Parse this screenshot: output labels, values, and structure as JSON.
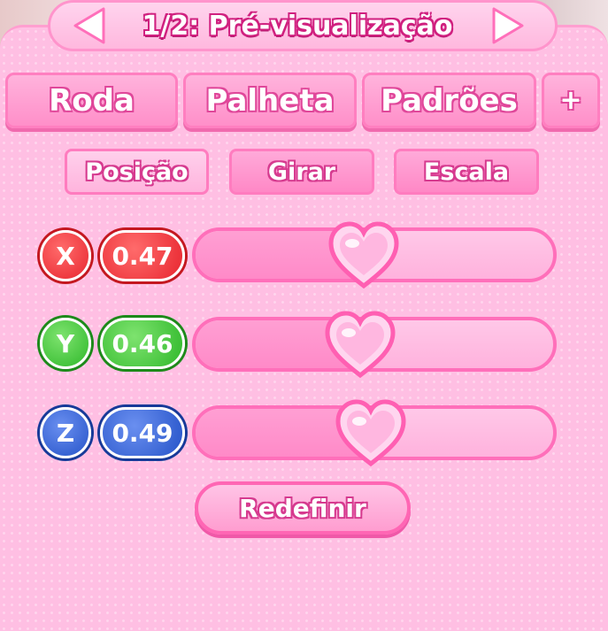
{
  "header": {
    "title": "1/2: Pré-visualização",
    "prev_icon": "chevron-left",
    "next_icon": "chevron-right"
  },
  "tabs": {
    "items": [
      {
        "label": "Roda"
      },
      {
        "label": "Palheta"
      },
      {
        "label": "Padrões"
      },
      {
        "label": "+"
      }
    ]
  },
  "subtabs": {
    "active": "Posição",
    "items": [
      {
        "label": "Posição"
      },
      {
        "label": "Girar"
      },
      {
        "label": "Escala"
      }
    ]
  },
  "sliders": [
    {
      "axis": "X",
      "value_text": "0.47",
      "value": 0.47,
      "color": "#e8262f"
    },
    {
      "axis": "Y",
      "value_text": "0.46",
      "value": 0.46,
      "color": "#2fb82a"
    },
    {
      "axis": "Z",
      "value_text": "0.49",
      "value": 0.49,
      "color": "#2553c8"
    }
  ],
  "reset_label": "Redefinir",
  "colors": {
    "accent": "#ff6fba",
    "panel": "#ffbfe3"
  }
}
